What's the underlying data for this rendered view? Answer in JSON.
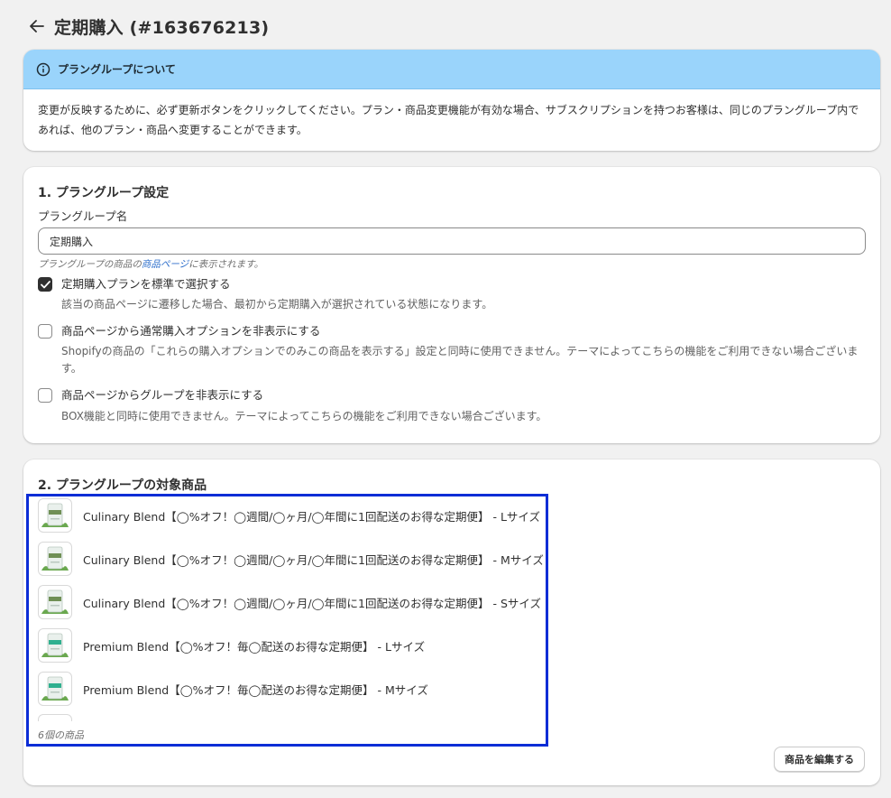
{
  "header": {
    "title": "定期購入 (#163676213)",
    "back_icon": "arrow-left-icon"
  },
  "banner": {
    "title": "プラングループについて",
    "icon": "info-icon",
    "body": "変更が反映するために、必ず更新ボタンをクリックしてください。プラン・商品変更機能が有効な場合、サブスクリプションを持つお客様は、同じのプラングループ内であれば、他のプラン・商品へ変更することができます。"
  },
  "settings": {
    "title": "1. プラングループ設定",
    "name_label": "プラングループ名",
    "name_value": "定期購入",
    "help_prefix": "プラングループの商品の",
    "help_link": "商品ページ",
    "help_suffix": "に表示されます。",
    "options": [
      {
        "label": "定期購入プランを標準で選択する",
        "checked": true,
        "desc": "該当の商品ページに遷移した場合、最初から定期購入が選択されている状態になります。"
      },
      {
        "label": "商品ページから通常購入オプションを非表示にする",
        "checked": false,
        "desc": "Shopifyの商品の「これらの購入オプションでのみこの商品を表示する」設定と同時に使用できません。テーマによってこちらの機能をご利用できない場合ございます。"
      },
      {
        "label": "商品ページからグループを非表示にする",
        "checked": false,
        "desc": "BOX機能と同時に使用できません。テーマによってこちらの機能をご利用できない場合ございます。"
      }
    ]
  },
  "products": {
    "title": "2. プラングループの対象商品",
    "items": [
      {
        "name": "Culinary Blend【◯%オフ！◯週間/◯ヶ月/◯年間に1回配送のお得な定期便】 - Lサイズ",
        "variant": "culinary"
      },
      {
        "name": "Culinary Blend【◯%オフ！◯週間/◯ヶ月/◯年間に1回配送のお得な定期便】 - Mサイズ",
        "variant": "culinary"
      },
      {
        "name": "Culinary Blend【◯%オフ！◯週間/◯ヶ月/◯年間に1回配送のお得な定期便】 - Sサイズ",
        "variant": "culinary"
      },
      {
        "name": "Premium Blend【◯%オフ！毎◯配送のお得な定期便】 - Lサイズ",
        "variant": "premium"
      },
      {
        "name": "Premium Blend【◯%オフ！毎◯配送のお得な定期便】 - Mサイズ",
        "variant": "premium"
      }
    ],
    "count_text": "6個の商品",
    "edit_button": "商品を編集する"
  },
  "colors": {
    "banner_bg": "#9ad4fb",
    "highlight": "#0c2dd6",
    "link": "#2c6ecb",
    "culinary_label": "#6f8f55",
    "premium_label": "#2fb08f"
  }
}
